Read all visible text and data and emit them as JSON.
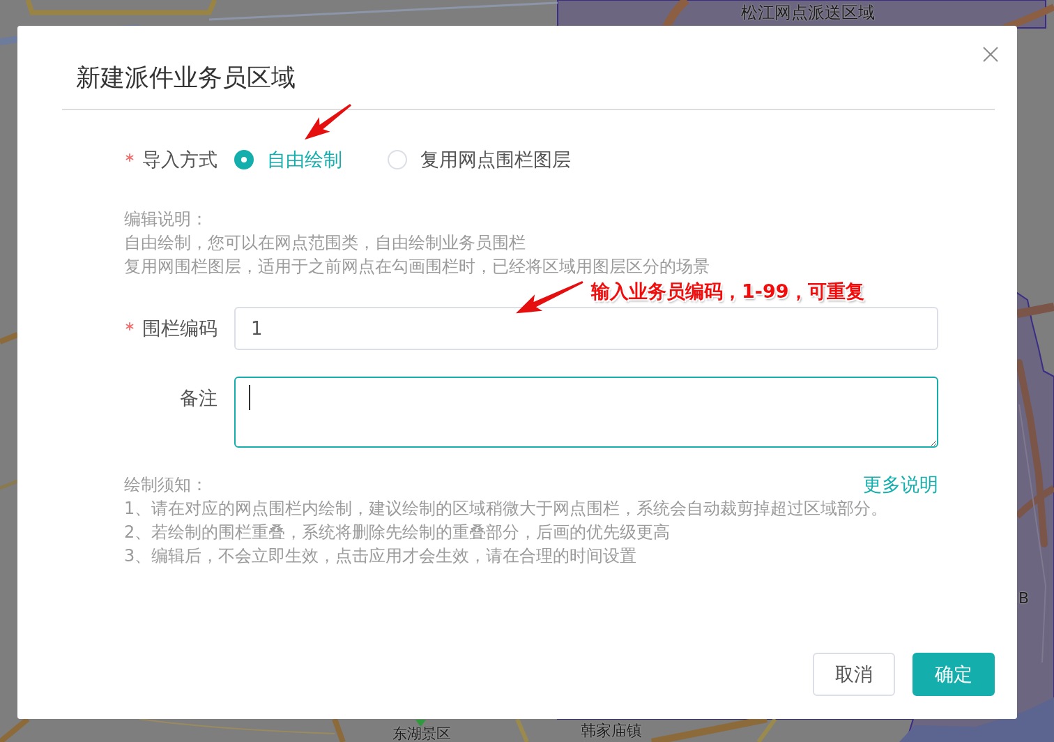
{
  "map": {
    "labels": [
      "松江网点派送区域",
      "韩家庙镇",
      "东湖景区",
      "B"
    ]
  },
  "dialog": {
    "title": "新建派件业务员区域",
    "import_method": {
      "label": "导入方式",
      "required": true,
      "options": [
        {
          "label": "自由绘制",
          "selected": true
        },
        {
          "label": "复用网点围栏图层",
          "selected": false
        }
      ]
    },
    "edit_notes": {
      "heading": "编辑说明：",
      "lines": [
        "自由绘制，您可以在网点范围类，自由绘制业务员围栏",
        "复用网围栏图层，适用于之前网点在勾画围栏时，已经将区域用图层区分的场景"
      ]
    },
    "fence_code": {
      "label": "围栏编码",
      "required": true,
      "value": "1"
    },
    "remark": {
      "label": "备注",
      "focused": true
    },
    "drawing_notes": {
      "heading": "绘制须知：",
      "link": "更多说明",
      "lines": [
        "1、请在对应的网点围栏内绘制，建议绘制的区域稍微大于网点围栏，系统会自动裁剪掉超过区域部分。",
        "2、若绘制的围栏重叠，系统将删除先绘制的重叠部分，后画的优先级更高",
        "3、编辑后，不会立即生效，点击应用才会生效，请在合理的时间设置"
      ]
    },
    "buttons": [
      {
        "label": "取消",
        "kind": "secondary"
      },
      {
        "label": "确定",
        "kind": "primary"
      }
    ]
  },
  "annotation": {
    "text": "输入业务员编码，1-99，可重复"
  }
}
